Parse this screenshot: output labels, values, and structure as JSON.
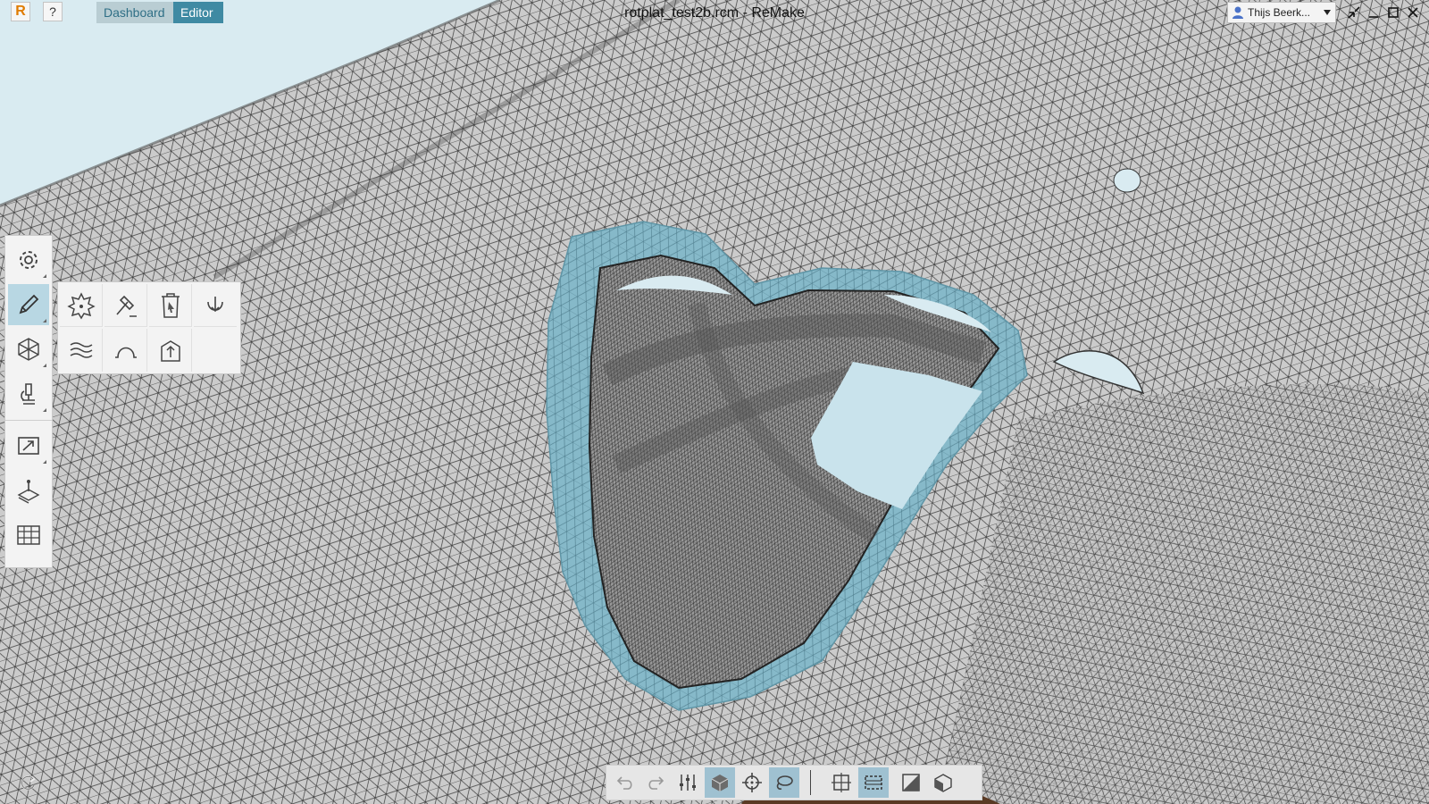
{
  "app": {
    "logo_letter": "R",
    "help_label": "?",
    "window_title": "rotplat_test2b.rcm - ReMake",
    "tabs": [
      {
        "label": "Dashboard",
        "active": false
      },
      {
        "label": "Editor",
        "active": true
      }
    ],
    "user_name": "Thijs Beerk...",
    "accent_color": "#3f8aa3",
    "logo_color": "#e07b00"
  },
  "left_toolbar": {
    "items": [
      {
        "icon": "gear-icon",
        "active": false
      },
      {
        "icon": "pencil-icon",
        "active": true
      },
      {
        "icon": "hexagon-mesh-icon",
        "active": false
      },
      {
        "icon": "microscope-icon",
        "active": false
      },
      {
        "icon": "export-icon",
        "active": false
      },
      {
        "icon": "layer-pin-icon",
        "active": false
      },
      {
        "icon": "grid-table-icon",
        "active": false
      }
    ]
  },
  "edit_flyout": {
    "tools": [
      {
        "icon": "gear-burst-icon"
      },
      {
        "icon": "hammer-icon"
      },
      {
        "icon": "trash-select-icon"
      },
      {
        "icon": "swirl-down-icon"
      },
      {
        "icon": "waves-icon"
      },
      {
        "icon": "arch-icon"
      },
      {
        "icon": "extrude-up-icon"
      }
    ]
  },
  "bottom_toolbar": {
    "items": [
      {
        "icon": "undo-icon",
        "active": false
      },
      {
        "icon": "redo-icon",
        "active": false
      },
      {
        "icon": "sliders-icon",
        "active": false
      },
      {
        "icon": "cube-icon",
        "active": true
      },
      {
        "icon": "crosshair-icon",
        "active": false
      },
      {
        "icon": "lasso-icon",
        "active": true
      },
      {
        "icon": "frame-icon",
        "active": false
      },
      {
        "icon": "selection-box-icon",
        "active": true
      },
      {
        "icon": "slice-icon",
        "active": false
      },
      {
        "icon": "half-cube-icon",
        "active": false
      }
    ]
  },
  "viewport": {
    "background_color": "#d9ebf1",
    "mesh_color": "#c9c9c9",
    "highlight_color": "#7fb3c4"
  }
}
